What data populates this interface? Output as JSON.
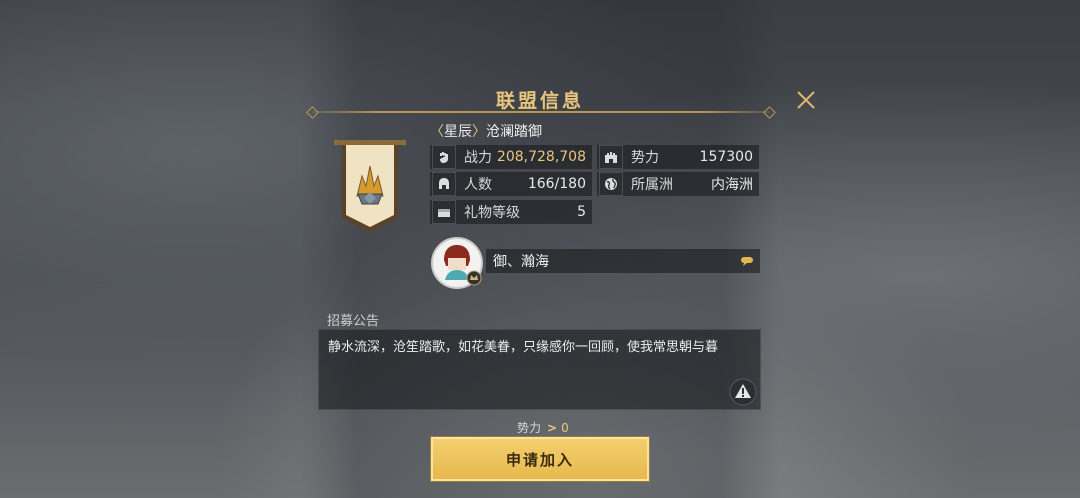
{
  "dialog": {
    "title": "联盟信息"
  },
  "alliance": {
    "tag_open": "〈",
    "tag": "星辰",
    "tag_close": "〉",
    "name": "沧澜踏御"
  },
  "stats": {
    "combat_power": {
      "label": "战力",
      "value": "208,728,708",
      "icon": "fist-icon"
    },
    "influence": {
      "label": "势力",
      "value": "157300",
      "icon": "castle-icon"
    },
    "members": {
      "label": "人数",
      "value": "166/180",
      "icon": "helmet-icon"
    },
    "continent": {
      "label": "所属洲",
      "value": "内海洲",
      "icon": "globe-icon"
    },
    "gift_level": {
      "label": "礼物等级",
      "value": "5",
      "icon": "gift-box-icon"
    }
  },
  "leader": {
    "name": "御、瀚海"
  },
  "recruit": {
    "label": "招募公告",
    "text": "静水流深，沧笙踏歌，如花美眷，只缘感你一回顾，使我常思朝与暮"
  },
  "requirement": {
    "label": "势力",
    "arrow": ">",
    "value": "0"
  },
  "apply_button": {
    "label": "申请加入"
  },
  "colors": {
    "gold_text": "#e9c57c",
    "button_gold": "#e7b94d"
  }
}
